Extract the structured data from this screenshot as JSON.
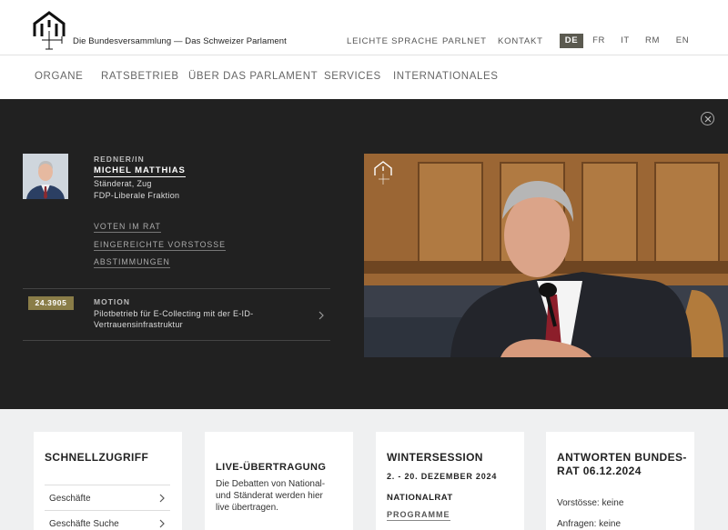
{
  "header": {
    "site_title": "Die Bundesversammlung — Das Schweizer Parlament",
    "util_links": [
      "LEICHTE SPRACHE",
      "PARLNET",
      "KONTAKT"
    ],
    "languages": [
      "DE",
      "FR",
      "IT",
      "RM",
      "EN"
    ],
    "active_language": "DE"
  },
  "nav": {
    "items": [
      "ORGANE",
      "RATSBETRIEB",
      "ÜBER DAS PARLAMENT",
      "SERVICES",
      "INTERNATIONALES"
    ]
  },
  "speaker": {
    "label": "REDNER/IN",
    "name": "MICHEL MATTHIAS",
    "council": "Ständerat, Zug",
    "faction": "FDP-Liberale Fraktion",
    "links": [
      "VOTEN IM RAT",
      "EINGEREICHTE VORSTOSSE",
      "ABSTIMMUNGEN"
    ]
  },
  "motion": {
    "number": "24.3905",
    "type": "MOTION",
    "title": "Pilotbetrieb für E-Collecting mit der E-ID-Vertrauensinfrastruktur"
  },
  "cards": {
    "quick": {
      "title": "SCHNELLZUGRIFF",
      "items": [
        "Geschäfte",
        "Geschäfte Suche"
      ]
    },
    "live": {
      "title": "LIVE-ÜBERTRAGUNG",
      "text": "Die Debatten von National- und Ständerat werden hier live übertragen."
    },
    "session": {
      "title": "WINTERSESSION",
      "dates": "2. - 20. DEZEMBER 2024",
      "council": "NATIONALRAT",
      "link": "PROGRAMME"
    },
    "answers": {
      "title": "ANTWORTEN BUNDES-RAT 06.12.2024",
      "lines": [
        "Vorstösse: keine",
        "Anfragen: keine"
      ]
    }
  },
  "colors": {
    "dark_bg": "#212121",
    "badge": "#8a7d48",
    "active_lang": "#5b5a50",
    "cards_bg": "#eff0f1"
  }
}
